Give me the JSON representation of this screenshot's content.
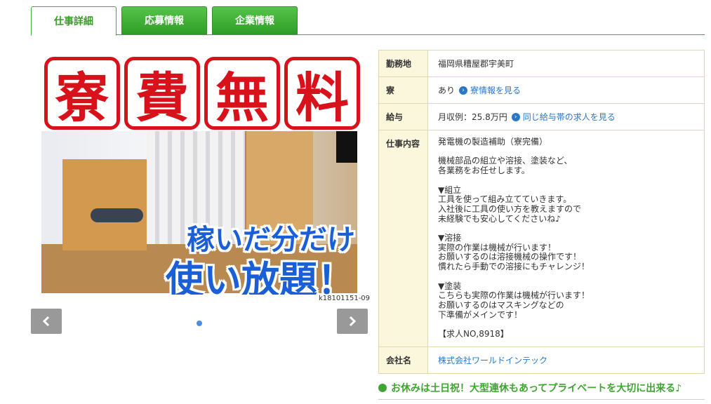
{
  "tabs": [
    "仕事詳細",
    "応募情報",
    "企業情報"
  ],
  "photo": {
    "banner_chars": [
      "寮",
      "費",
      "無",
      "料"
    ],
    "slogan_line1": "稼いだ分だけ",
    "slogan_line2": "使い放題！",
    "code": "k18101151-09"
  },
  "carousel": {
    "prev_icon": "chevron-left-icon",
    "next_icon": "chevron-right-icon"
  },
  "details": {
    "location_label": "勤務地",
    "location_value": "福岡県糟屋郡宇美町",
    "dorm_label": "寮",
    "dorm_value": "あり",
    "dorm_link": "寮情報を見る",
    "salary_label": "給与",
    "salary_value": "月収例：25.8万円",
    "salary_link": "同じ給与帯の求人を見る",
    "job_label": "仕事内容",
    "job_value": "発電機の製造補助（寮完備）\n\n機械部品の組立や溶接、塗装など、\n各業務をお任せします。\n\n▼組立\n工具を使って組み立てていきます。\n入社後に工具の使い方を教えますので\n未経験でも安心してくださいね♪\n\n▼溶接\n実際の作業は機械が行います！\nお願いするのは溶接機械の操作です！\n慣れたら手動での溶接にもチャレンジ！\n\n▼塗装\nこちらも実際の作業は機械が行います！\nお願いするのはマスキングなどの\n下準備がメインです！\n\n【求人NO,8918】",
    "company_label": "会社名",
    "company_value": "株式会社ワールドインテック"
  },
  "footer_note": "お休みは土日祝！大型連休もあってプライベートを大切に出来る♪",
  "colors": {
    "accent": "#3cab3c",
    "banner_red": "#d8121b",
    "link": "#2a76c8"
  }
}
